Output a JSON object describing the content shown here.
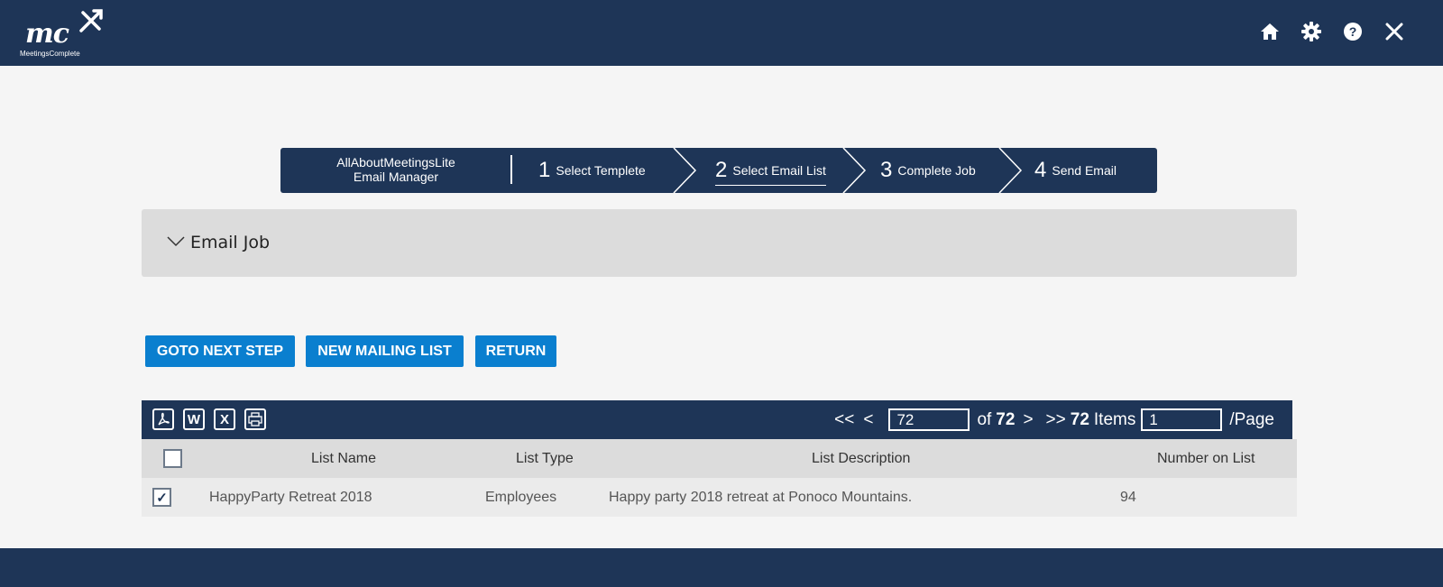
{
  "header": {
    "logo_text": "mc",
    "logo_subtitle": "MeetingsComplete",
    "icons": [
      "home-icon",
      "gear-icon",
      "help-icon",
      "close-icon"
    ]
  },
  "stepper": {
    "app_line1": "AllAboutMeetingsLite",
    "app_line2": "Email Manager",
    "steps": [
      {
        "num": "1",
        "label": "Select Templete"
      },
      {
        "num": "2",
        "label": "Select Email List"
      },
      {
        "num": "3",
        "label": "Complete Job"
      },
      {
        "num": "4",
        "label": "Send Email"
      }
    ],
    "active_step": 2
  },
  "accordion": {
    "label": "Email Job"
  },
  "buttons": {
    "next": "GOTO NEXT STEP",
    "new_list": "NEW MAILING LIST",
    "return": "RETURN"
  },
  "toolbar": {
    "export_icons": [
      "pdf-icon",
      "word-icon",
      "excel-icon",
      "print-icon"
    ],
    "first": "<<",
    "prev": "<",
    "page_value": "72",
    "of_text": "of",
    "total_pages": "72",
    "next": ">",
    "last": ">>",
    "items_count": "72",
    "items_label": "Items",
    "per_page_value": "1",
    "per_page_label": "/Page"
  },
  "grid": {
    "columns": [
      "List Name",
      "List Type",
      "List Description",
      "Number on List"
    ],
    "rows": [
      {
        "checked": true,
        "name": "HappyParty Retreat 2018",
        "type": "Employees",
        "description": "Happy party 2018 retreat at Ponoco Mountains.",
        "count": "94"
      }
    ]
  },
  "colors": {
    "navy": "#1e3557",
    "accent_blue": "#0a7fcf",
    "panel_gray": "#dcdcdc"
  }
}
